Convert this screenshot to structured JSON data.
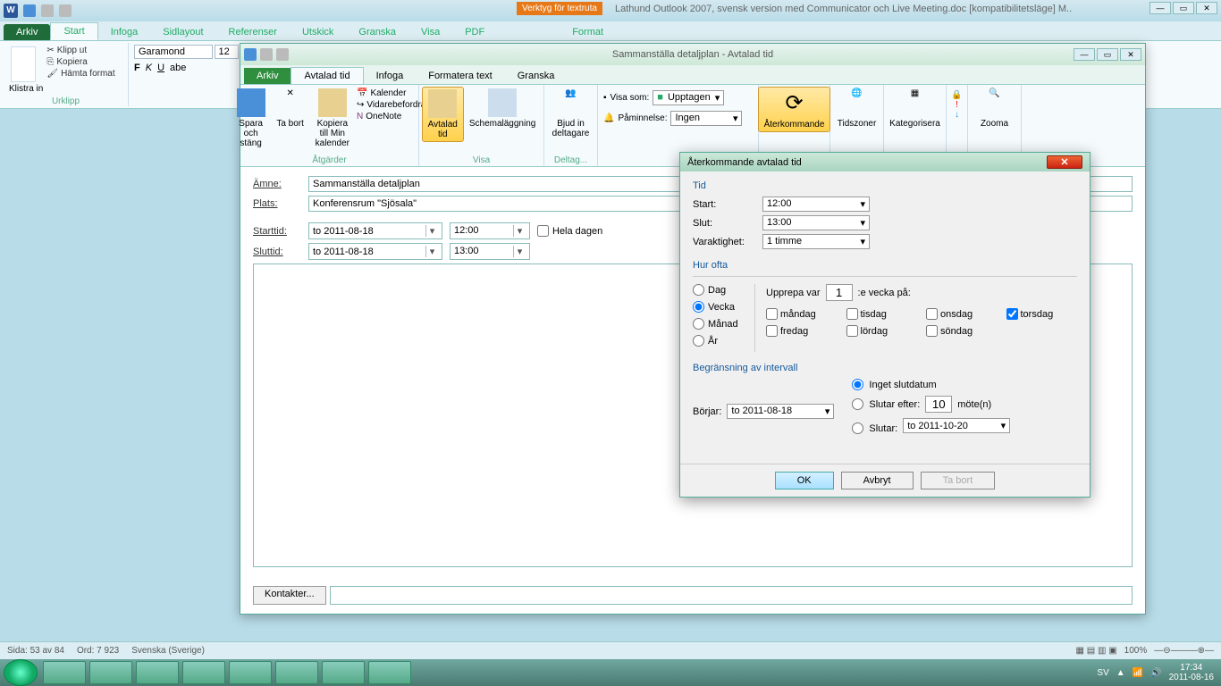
{
  "word": {
    "textruta_tag": "Verktyg för textruta",
    "doc_title": "Lathund Outlook 2007, svensk version med Communicator och Live Meeting.doc [kompatibilitetsläge] M..",
    "tabs": {
      "arkiv": "Arkiv",
      "start": "Start",
      "infoga": "Infoga",
      "sidlayout": "Sidlayout",
      "referenser": "Referenser",
      "utskick": "Utskick",
      "granska": "Granska",
      "visa": "Visa",
      "pdf": "PDF",
      "format": "Format"
    },
    "clipboard": {
      "klistra": "Klistra in",
      "klipp": "Klipp ut",
      "kopiera": "Kopiera",
      "hamta": "Hämta format",
      "group": "Urklipp"
    },
    "font": {
      "name": "Garamond",
      "size": "12"
    }
  },
  "outlook": {
    "title": "Sammanställa detaljplan  -  Avtalad tid",
    "tabs": {
      "arkiv": "Arkiv",
      "avtalad": "Avtalad tid",
      "infoga": "Infoga",
      "formatera": "Formatera text",
      "granska": "Granska"
    },
    "ribbon": {
      "spara": "Spara och stäng",
      "tabort": "Ta bort",
      "kopiera": "Kopiera till Min kalender",
      "kalender": "Kalender",
      "vidare": "Vidarebefordra",
      "onenote": "OneNote",
      "atgarder": "Åtgärder",
      "avtaladtid": "Avtalad tid",
      "schema": "Schemaläggning",
      "visa": "Visa",
      "bjud": "Bjud in deltagare",
      "deltag": "Deltag...",
      "visa_som": "Visa som:",
      "upptagen": "Upptagen",
      "paminnelse": "Påminnelse:",
      "ingen": "Ingen",
      "aterkommande": "Återkommande",
      "tidszoner": "Tidszoner",
      "kategorisera": "Kategorisera",
      "zooma": "Zooma"
    },
    "form": {
      "amne_l": "Ämne:",
      "amne_v": "Sammanställa detaljplan",
      "plats_l": "Plats:",
      "plats_v": "Konferensrum \"Sjösala\"",
      "starttid_l": "Starttid:",
      "start_d": "to 2011-08-18",
      "start_t": "12:00",
      "sluttid_l": "Sluttid:",
      "slut_d": "to 2011-08-18",
      "slut_t": "13:00",
      "heladagen": "Hela dagen",
      "kontakter": "Kontakter..."
    }
  },
  "recur": {
    "title": "Återkommande avtalad tid",
    "tid": "Tid",
    "start_l": "Start:",
    "start_v": "12:00",
    "slut_l": "Slut:",
    "slut_v": "13:00",
    "varaktighet_l": "Varaktighet:",
    "varaktighet_v": "1 timme",
    "hurofta": "Hur ofta",
    "dag": "Dag",
    "vecka": "Vecka",
    "manad": "Månad",
    "ar": "År",
    "upprepa": "Upprepa var",
    "upprepa_v": "1",
    "evecka": ":e vecka på:",
    "days": {
      "mon": "måndag",
      "tue": "tisdag",
      "wed": "onsdag",
      "thu": "torsdag",
      "fri": "fredag",
      "sat": "lördag",
      "sun": "söndag"
    },
    "begransning": "Begränsning av intervall",
    "borjar_l": "Börjar:",
    "borjar_v": "to 2011-08-18",
    "inget": "Inget slutdatum",
    "slutarefter": "Slutar efter:",
    "moten_v": "10",
    "moten": "möte(n)",
    "slutar": "Slutar:",
    "slutar_v": "to 2011-10-20",
    "ok": "OK",
    "avbryt": "Avbryt",
    "tabort": "Ta bort"
  },
  "status": {
    "sida": "Sida: 53 av 84",
    "ord": "Ord: 7 923",
    "lang": "Svenska (Sverige)",
    "zoom": "100%"
  },
  "tray": {
    "lang": "SV",
    "time": "17:34",
    "date": "2011-08-16"
  }
}
